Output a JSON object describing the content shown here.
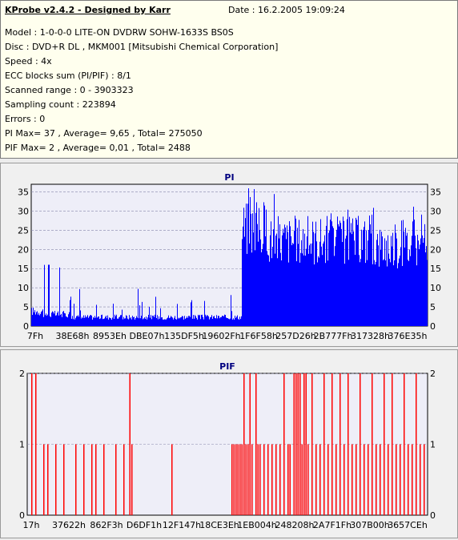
{
  "header": {
    "title": "KProbe v2.4.2 - Designed by Karr",
    "date": "Date : 16.2.2005 19:09:24"
  },
  "info_lines": [
    "Model : 1-0-0-0 LITE-ON DVDRW SOHW-1633S BS0S",
    "Disc : DVD+R DL , MKM001 [Mitsubishi Chemical Corporation]",
    "Speed : 4x",
    "ECC blocks sum (PI/PIF) : 8/1",
    "Scanned range : 0 - 3903323",
    "Sampling count : 223894",
    "Errors : 0",
    "PI Max= 37 , Average= 9,65 , Total= 275050",
    "PIF Max= 2 , Average= 0,01 , Total= 2488"
  ],
  "chart_data": [
    {
      "type": "bar",
      "title": "PI",
      "ylim": [
        0,
        37
      ],
      "y_ticks": [
        0,
        5,
        10,
        15,
        20,
        25,
        30,
        35
      ],
      "x_tick_labels": [
        "7Fh",
        "38E68h",
        "8953Eh",
        "DBE07h",
        "135DF5h",
        "19602Fh",
        "1F6F58h",
        "257D26h",
        "2B777Fh",
        "317328h",
        "376E35h"
      ],
      "color": "#0000ff",
      "grid": true,
      "segments": [
        {
          "from": 0.0,
          "to": 0.03,
          "typical": 5,
          "peak": 10
        },
        {
          "from": 0.03,
          "to": 0.1,
          "typical": 4,
          "peak": 16
        },
        {
          "from": 0.1,
          "to": 0.53,
          "typical": 3,
          "peak": 11
        },
        {
          "from": 0.53,
          "to": 0.6,
          "typical": 33,
          "peak": 37
        },
        {
          "from": 0.6,
          "to": 0.85,
          "typical": 29,
          "peak": 37
        },
        {
          "from": 0.85,
          "to": 1.0,
          "typical": 27,
          "peak": 32
        }
      ]
    },
    {
      "type": "bar",
      "title": "PIF",
      "ylim": [
        0,
        2
      ],
      "y_ticks": [
        0,
        1,
        2
      ],
      "x_tick_labels": [
        "17h",
        "37622h",
        "862F3h",
        "D6DF1h",
        "12F147h",
        "18CE3Eh",
        "1EB004h",
        "248208h",
        "2A7F1Fh",
        "307B00h",
        "3657CEh"
      ],
      "color": "#ff0000",
      "grid": true,
      "spikes": [
        {
          "x": 0.01,
          "v": 2
        },
        {
          "x": 0.02,
          "v": 2
        },
        {
          "x": 0.04,
          "v": 1
        },
        {
          "x": 0.05,
          "v": 1
        },
        {
          "x": 0.07,
          "v": 1
        },
        {
          "x": 0.09,
          "v": 1
        },
        {
          "x": 0.12,
          "v": 1
        },
        {
          "x": 0.14,
          "v": 1
        },
        {
          "x": 0.16,
          "v": 1
        },
        {
          "x": 0.17,
          "v": 1
        },
        {
          "x": 0.19,
          "v": 1
        },
        {
          "x": 0.22,
          "v": 1
        },
        {
          "x": 0.24,
          "v": 1
        },
        {
          "x": 0.255,
          "v": 2
        },
        {
          "x": 0.26,
          "v": 1
        },
        {
          "x": 0.36,
          "v": 1
        },
        {
          "x": 0.51,
          "v": 1
        },
        {
          "x": 0.515,
          "v": 1
        },
        {
          "x": 0.52,
          "v": 1
        },
        {
          "x": 0.525,
          "v": 1
        },
        {
          "x": 0.53,
          "v": 1
        },
        {
          "x": 0.535,
          "v": 1
        },
        {
          "x": 0.54,
          "v": 2
        },
        {
          "x": 0.545,
          "v": 1
        },
        {
          "x": 0.55,
          "v": 1
        },
        {
          "x": 0.555,
          "v": 2
        },
        {
          "x": 0.56,
          "v": 1
        },
        {
          "x": 0.57,
          "v": 2
        },
        {
          "x": 0.575,
          "v": 1
        },
        {
          "x": 0.58,
          "v": 1
        },
        {
          "x": 0.59,
          "v": 1
        },
        {
          "x": 0.6,
          "v": 1
        },
        {
          "x": 0.61,
          "v": 1
        },
        {
          "x": 0.62,
          "v": 1
        },
        {
          "x": 0.63,
          "v": 1
        },
        {
          "x": 0.64,
          "v": 2
        },
        {
          "x": 0.65,
          "v": 1
        },
        {
          "x": 0.655,
          "v": 1
        },
        {
          "x": 0.665,
          "v": 2
        },
        {
          "x": 0.67,
          "v": 2
        },
        {
          "x": 0.675,
          "v": 2
        },
        {
          "x": 0.68,
          "v": 2
        },
        {
          "x": 0.685,
          "v": 1
        },
        {
          "x": 0.69,
          "v": 2
        },
        {
          "x": 0.695,
          "v": 2
        },
        {
          "x": 0.7,
          "v": 1
        },
        {
          "x": 0.71,
          "v": 2
        },
        {
          "x": 0.72,
          "v": 1
        },
        {
          "x": 0.73,
          "v": 1
        },
        {
          "x": 0.74,
          "v": 2
        },
        {
          "x": 0.75,
          "v": 1
        },
        {
          "x": 0.76,
          "v": 2
        },
        {
          "x": 0.77,
          "v": 1
        },
        {
          "x": 0.78,
          "v": 2
        },
        {
          "x": 0.79,
          "v": 1
        },
        {
          "x": 0.8,
          "v": 2
        },
        {
          "x": 0.81,
          "v": 1
        },
        {
          "x": 0.82,
          "v": 1
        },
        {
          "x": 0.83,
          "v": 2
        },
        {
          "x": 0.84,
          "v": 1
        },
        {
          "x": 0.85,
          "v": 1
        },
        {
          "x": 0.86,
          "v": 2
        },
        {
          "x": 0.87,
          "v": 1
        },
        {
          "x": 0.88,
          "v": 1
        },
        {
          "x": 0.89,
          "v": 2
        },
        {
          "x": 0.9,
          "v": 1
        },
        {
          "x": 0.91,
          "v": 2
        },
        {
          "x": 0.92,
          "v": 1
        },
        {
          "x": 0.93,
          "v": 1
        },
        {
          "x": 0.94,
          "v": 2
        },
        {
          "x": 0.95,
          "v": 1
        },
        {
          "x": 0.96,
          "v": 1
        },
        {
          "x": 0.97,
          "v": 2
        },
        {
          "x": 0.98,
          "v": 1
        },
        {
          "x": 0.99,
          "v": 1
        }
      ]
    }
  ]
}
